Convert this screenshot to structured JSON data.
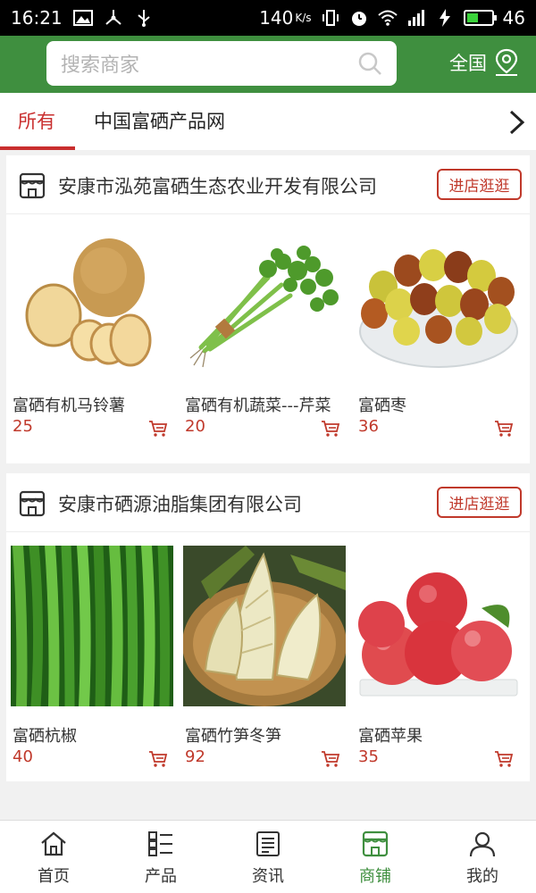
{
  "status_bar": {
    "time": "16:21",
    "net_speed": "140",
    "net_unit": "K/s",
    "battery_level": "46",
    "battery_fill_percent": 46
  },
  "header": {
    "search_placeholder": "搜索商家",
    "region_label": "全国"
  },
  "tabs": [
    {
      "label": "所有",
      "active": true
    },
    {
      "label": "中国富硒产品网",
      "active": false
    }
  ],
  "shops": [
    {
      "name": "安康市泓苑富硒生态农业开发有限公司",
      "visit_label": "进店逛逛",
      "products": [
        {
          "name": "富硒有机马铃薯",
          "price": "25"
        },
        {
          "name": "富硒有机蔬菜---芹菜",
          "price": "20"
        },
        {
          "name": "富硒枣",
          "price": "36"
        }
      ]
    },
    {
      "name": "安康市硒源油脂集团有限公司",
      "visit_label": "进店逛逛",
      "products": [
        {
          "name": "富硒杭椒",
          "price": "40"
        },
        {
          "name": "富硒竹笋冬笋",
          "price": "92"
        },
        {
          "name": "富硒苹果",
          "price": "35"
        }
      ]
    }
  ],
  "bottom_nav": [
    {
      "label": "首页",
      "icon": "home-icon",
      "active": false
    },
    {
      "label": "产品",
      "icon": "list-icon",
      "active": false
    },
    {
      "label": "资讯",
      "icon": "news-icon",
      "active": false
    },
    {
      "label": "商铺",
      "icon": "store-icon",
      "active": true
    },
    {
      "label": "我的",
      "icon": "user-icon",
      "active": false
    }
  ],
  "colors": {
    "brand_green": "#3f8f3f",
    "accent_red": "#c92e2e",
    "price_red": "#c0392b"
  }
}
